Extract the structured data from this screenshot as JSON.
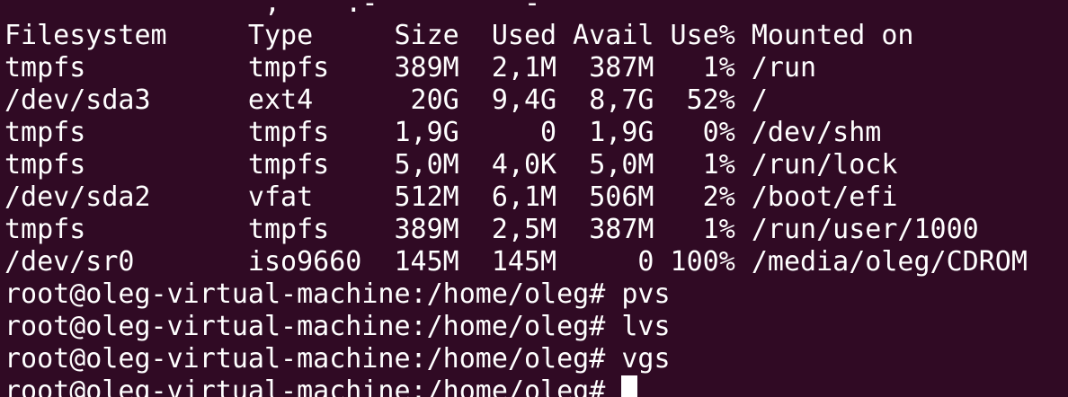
{
  "terminal": {
    "partial_top_line": "               ',  ' .-       ' -'",
    "df_header": "Filesystem     Type     Size  Used Avail Use% Mounted on",
    "df_rows": [
      "tmpfs          tmpfs    389M  2,1M  387M   1% /run",
      "/dev/sda3      ext4      20G  9,4G  8,7G  52% /",
      "tmpfs          tmpfs    1,9G     0  1,9G   0% /dev/shm",
      "tmpfs          tmpfs    5,0M  4,0K  5,0M   1% /run/lock",
      "/dev/sda2      vfat     512M  6,1M  506M   2% /boot/efi",
      "tmpfs          tmpfs    389M  2,5M  387M   1% /run/user/1000",
      "/dev/sr0       iso9660  145M  145M     0 100% /media/oleg/CDROM"
    ],
    "commands": [
      "root@oleg-virtual-machine:/home/oleg# pvs",
      "root@oleg-virtual-machine:/home/oleg# lvs",
      "root@oleg-virtual-machine:/home/oleg# vgs"
    ],
    "current_prompt": "root@oleg-virtual-machine:/home/oleg# "
  }
}
